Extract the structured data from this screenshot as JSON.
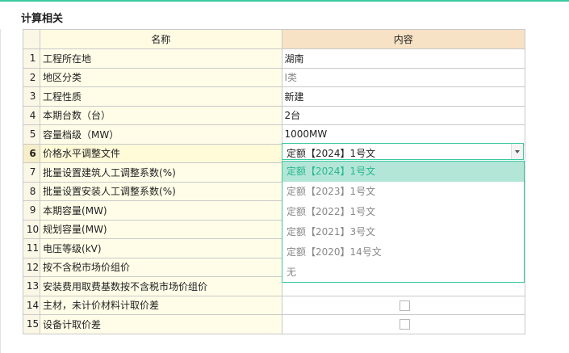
{
  "section_title": "计算相关",
  "table": {
    "headers": {
      "name": "名称",
      "content": "内容"
    },
    "rows": [
      {
        "idx": "1",
        "name": "工程所在地",
        "value": "湖南",
        "type": "text"
      },
      {
        "idx": "2",
        "name": "地区分类",
        "value": "Ⅰ类",
        "type": "text",
        "muted": true
      },
      {
        "idx": "3",
        "name": "工程性质",
        "value": "新建",
        "type": "text"
      },
      {
        "idx": "4",
        "name": "本期台数（台）",
        "value": "2台",
        "type": "text"
      },
      {
        "idx": "5",
        "name": "容量档级（MW）",
        "value": "1000MW",
        "type": "text"
      },
      {
        "idx": "6",
        "name": "价格水平调整文件",
        "value": "",
        "type": "select",
        "active": true
      },
      {
        "idx": "7",
        "name": "批量设置建筑人工调整系数(%)",
        "value": "",
        "type": "text"
      },
      {
        "idx": "8",
        "name": "批量设置安装人工调整系数(%)",
        "value": "",
        "type": "text"
      },
      {
        "idx": "9",
        "name": "本期容量(MW)",
        "value": "",
        "type": "text"
      },
      {
        "idx": "10",
        "name": "规划容量(MW)",
        "value": "",
        "type": "text"
      },
      {
        "idx": "11",
        "name": "电压等级(kV)",
        "value": "",
        "type": "text"
      },
      {
        "idx": "12",
        "name": "按不含税市场价组价",
        "value": "",
        "type": "text"
      },
      {
        "idx": "13",
        "name": "安装费用取费基数按不含税市场价组价",
        "value": "",
        "type": "text"
      },
      {
        "idx": "14",
        "name": "主材，未计价材料计取价差",
        "type": "checkbox",
        "checked": false
      },
      {
        "idx": "15",
        "name": "设备计取价差",
        "type": "checkbox",
        "checked": false
      }
    ]
  },
  "price_file_select": {
    "value": "定额【2024】1号文",
    "options": [
      {
        "label": "定额【2024】1号文",
        "selected": true
      },
      {
        "label": "定额【2023】1号文",
        "selected": false
      },
      {
        "label": "定额【2022】1号文",
        "selected": false
      },
      {
        "label": "定额【2021】3号文",
        "selected": false
      },
      {
        "label": "定额【2020】14号文",
        "selected": false
      },
      {
        "label": "无",
        "selected": false
      }
    ]
  },
  "colors": {
    "accent": "#3cc9a0",
    "selected_option_bg": "#b3e6d6",
    "header_content_bg": "#f8e2c5",
    "name_column_bg": "#fffde8"
  }
}
